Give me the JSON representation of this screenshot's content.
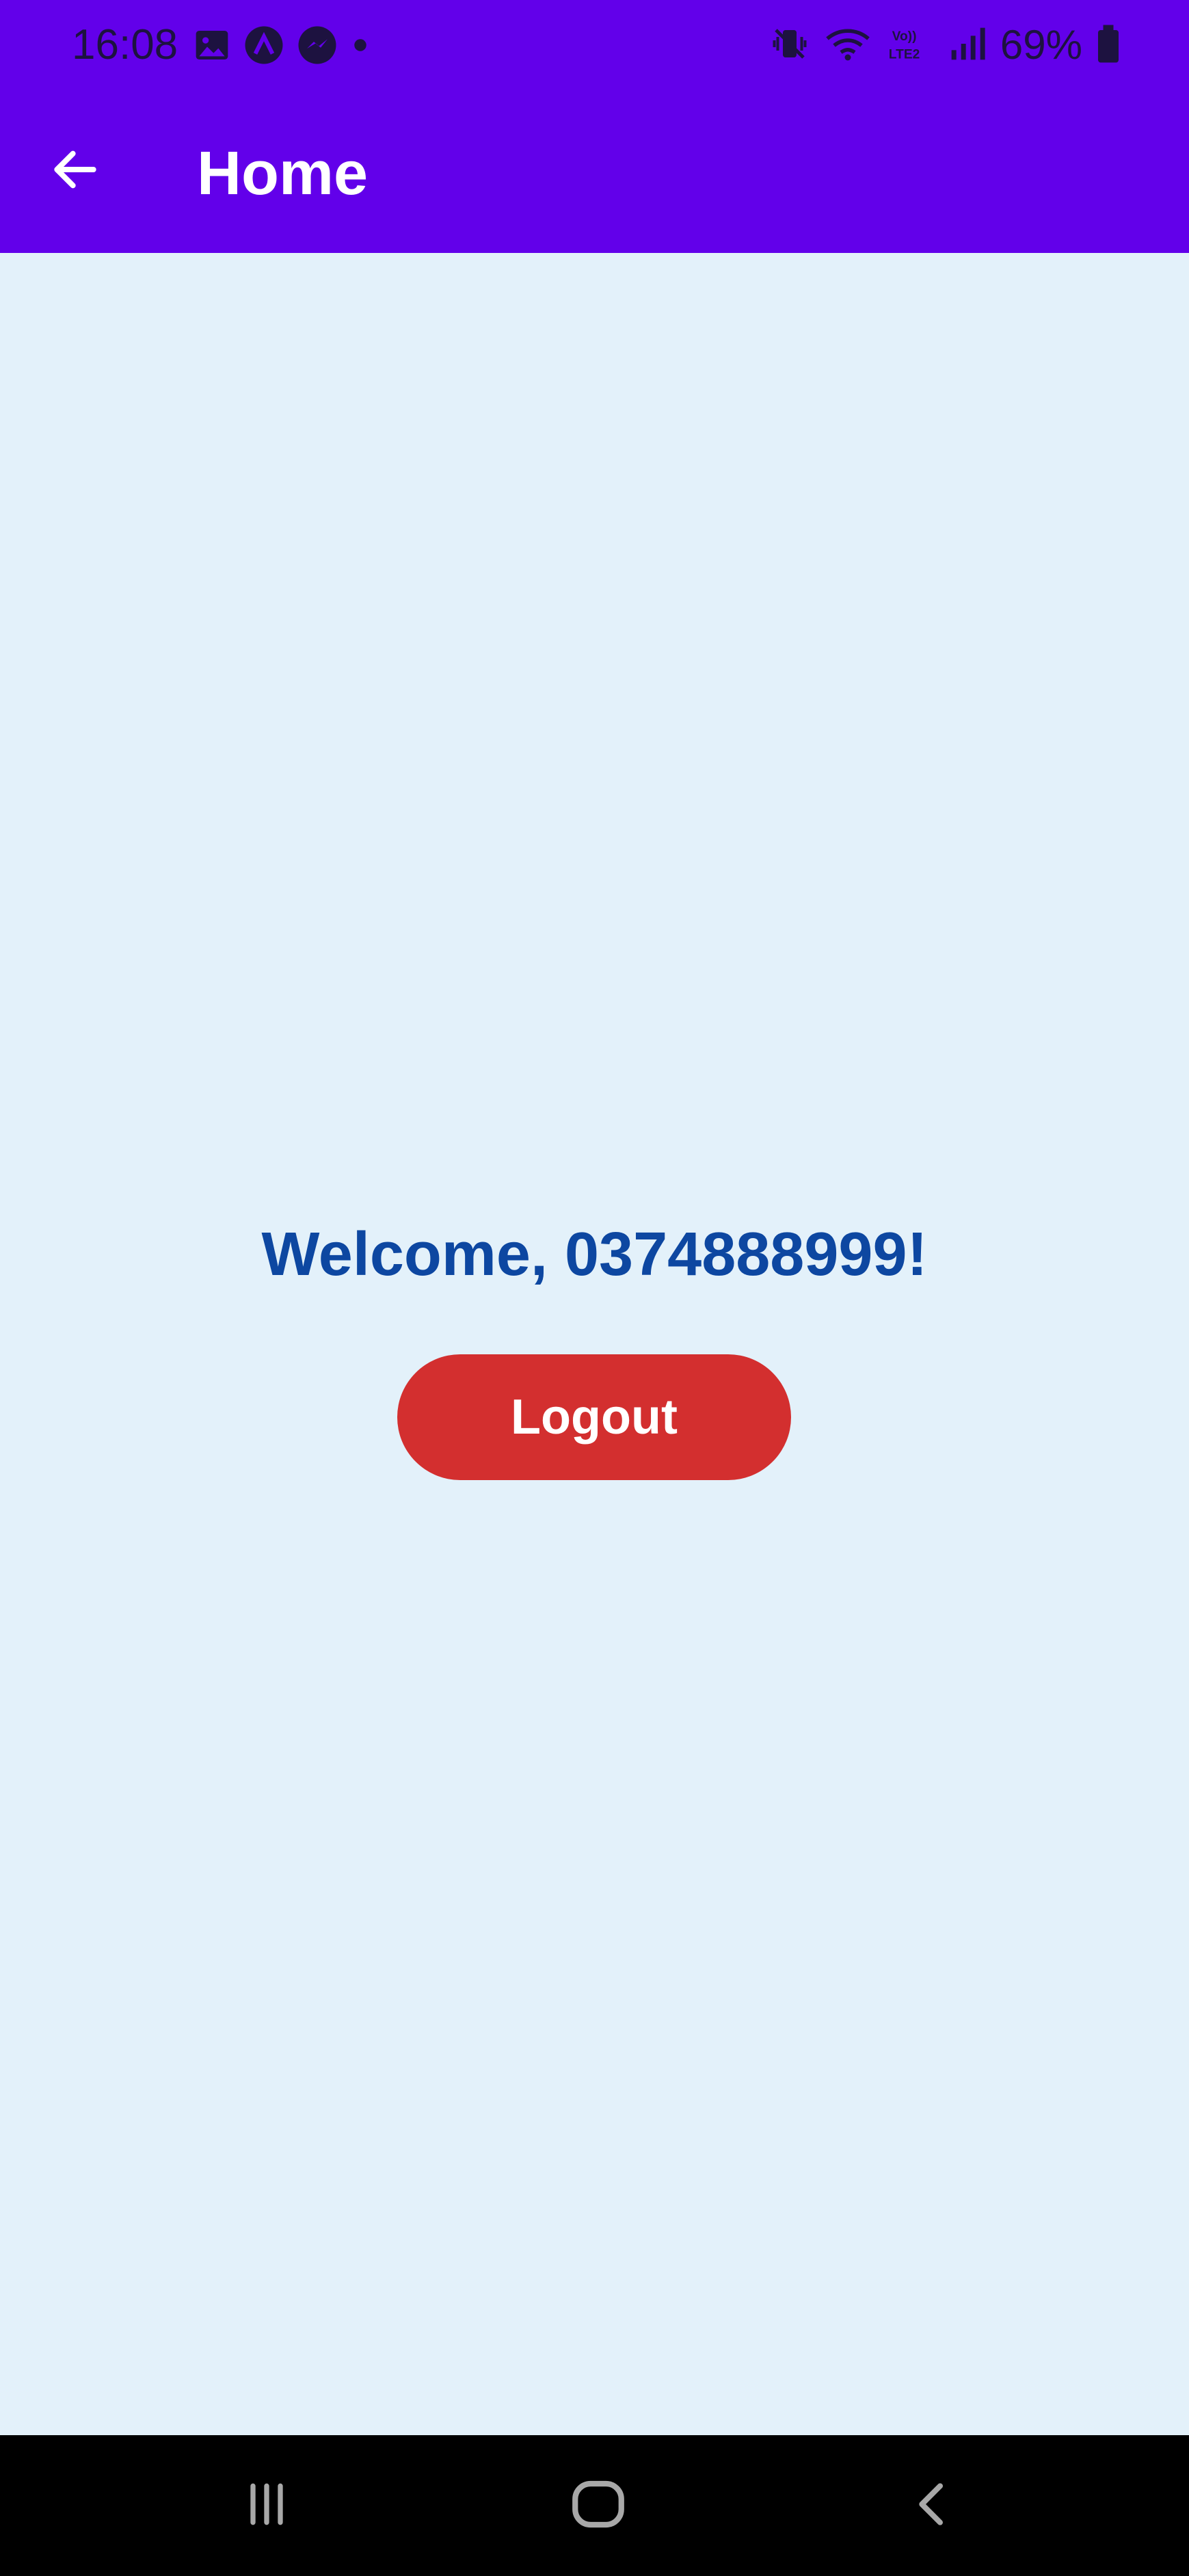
{
  "status_bar": {
    "time": "16:08",
    "left_icons": [
      "image-icon",
      "app-a-icon",
      "messenger-icon",
      "dot-icon"
    ],
    "right_icons": [
      "mute-vibrate-icon",
      "wifi-icon",
      "volte-lte2-icon",
      "signal-icon",
      "battery-icon"
    ],
    "volte_label": "Vo)) LTE2",
    "battery_percent": "69%"
  },
  "app_bar": {
    "title": "Home",
    "back_icon": "arrow-left-icon",
    "background": "#6200ea"
  },
  "main": {
    "welcome_text": "Welcome, 0374888999!",
    "welcome_color": "#0d47a1",
    "logout_label": "Logout",
    "logout_color": "#d32f2f",
    "background": "#e3f1fa"
  },
  "nav_bar": {
    "buttons": [
      "recents-icon",
      "home-icon",
      "back-icon"
    ]
  }
}
